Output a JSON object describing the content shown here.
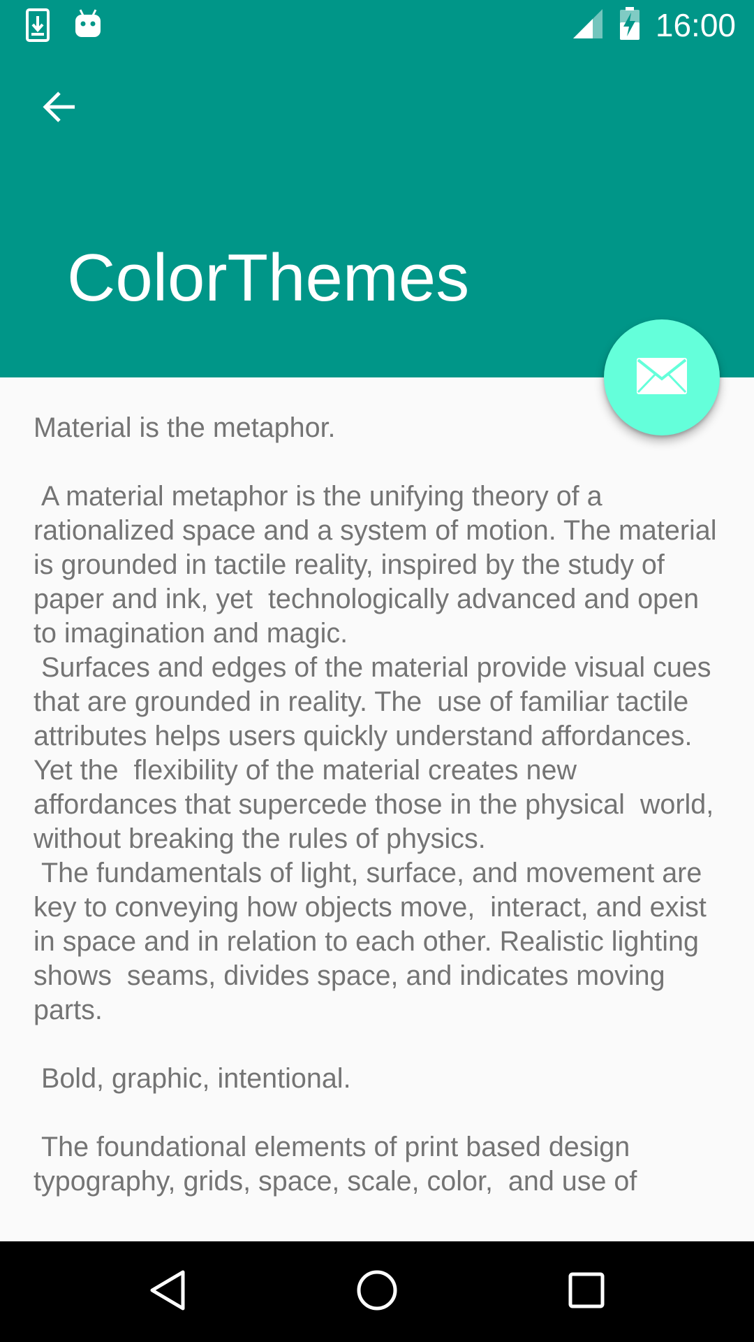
{
  "status_bar": {
    "time": "16:00",
    "left_icons": [
      "download-icon",
      "android-icon"
    ],
    "right_icons": [
      "signal-icon",
      "battery-charging-icon"
    ]
  },
  "app_bar": {
    "title": "ColorThemes",
    "back_icon": "back-arrow-icon"
  },
  "fab": {
    "icon": "mail-icon"
  },
  "body": {
    "paragraphs": [
      "Material is the metaphor.",
      "",
      " A material metaphor is the unifying theory of a rationalized space and a system of motion. The material is grounded in tactile reality, inspired by the study of paper and ink, yet  technologically advanced and open to imagination and magic.",
      " Surfaces and edges of the material provide visual cues that are grounded in reality. The  use of familiar tactile attributes helps users quickly understand affordances. Yet the  flexibility of the material creates new affordances that supercede those in the physical  world, without breaking the rules of physics.",
      " The fundamentals of light, surface, and movement are key to conveying how objects move,  interact, and exist in space and in relation to each other. Realistic lighting shows  seams, divides space, and indicates moving parts.",
      "",
      " Bold, graphic, intentional.",
      "",
      " The foundational elements of print based design typography, grids, space, scale, color,  and use of"
    ]
  },
  "nav_bar": {
    "buttons": [
      "back-triangle-icon",
      "home-circle-icon",
      "recents-square-icon"
    ]
  },
  "colors": {
    "primary": "#009688",
    "accent": "#64FFDA",
    "background": "#FAFAFA",
    "body_text": "#747474",
    "nav_bar": "#000000"
  }
}
